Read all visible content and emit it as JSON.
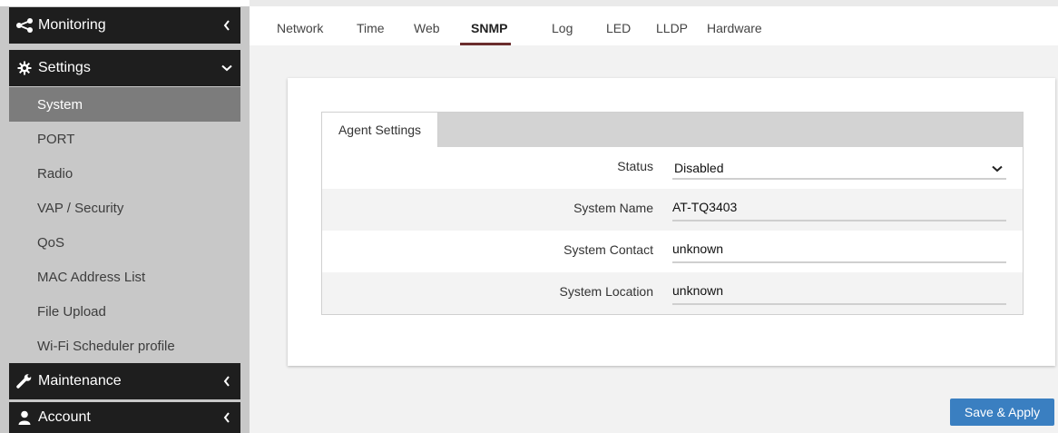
{
  "sidebar": {
    "sections": {
      "monitoring": {
        "label": "Monitoring",
        "icon": "share-icon"
      },
      "settings": {
        "label": "Settings",
        "icon": "gear-icon"
      },
      "maintenance": {
        "label": "Maintenance",
        "icon": "wrench-icon"
      },
      "account": {
        "label": "Account",
        "icon": "user-icon"
      }
    },
    "items": [
      {
        "label": "System",
        "active": true
      },
      {
        "label": "PORT"
      },
      {
        "label": "Radio"
      },
      {
        "label": "VAP / Security"
      },
      {
        "label": "QoS"
      },
      {
        "label": "MAC Address List"
      },
      {
        "label": "File Upload"
      },
      {
        "label": "Wi-Fi Scheduler profile"
      }
    ]
  },
  "topnav": {
    "tabs": [
      {
        "label": "Network"
      },
      {
        "label": "Time"
      },
      {
        "label": "Web"
      },
      {
        "label": "SNMP",
        "active": true
      },
      {
        "label": "Log"
      },
      {
        "label": "LED"
      },
      {
        "label": "LLDP"
      },
      {
        "label": "Hardware"
      }
    ]
  },
  "panel": {
    "tab_label": "Agent Settings",
    "fields": {
      "status": {
        "label": "Status",
        "value": "Disabled"
      },
      "system_name": {
        "label": "System Name",
        "value": "AT-TQ3403"
      },
      "system_contact": {
        "label": "System Contact",
        "value": "unknown"
      },
      "system_location": {
        "label": "System Location",
        "value": "unknown"
      }
    }
  },
  "actions": {
    "save_label": "Save & Apply"
  },
  "colors": {
    "accent": "#3a7fc1",
    "active_tab_underline": "#6b2d2d",
    "sidebar_dark": "#1e1e1e",
    "sidebar_active": "#7c7c7c"
  }
}
